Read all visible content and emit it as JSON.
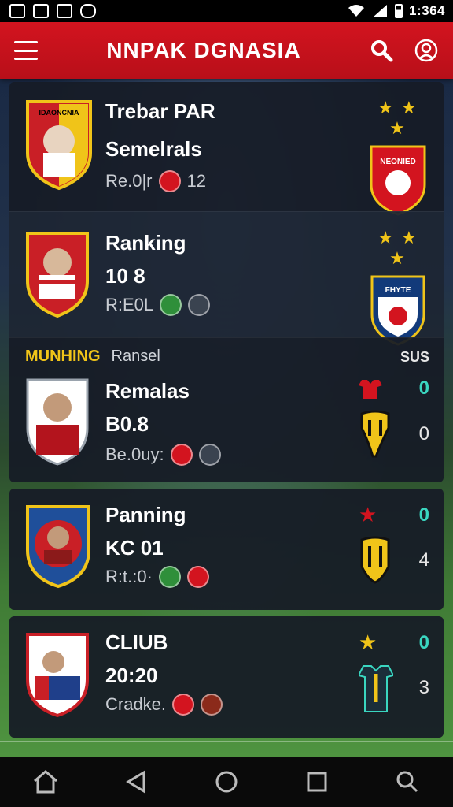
{
  "status_bar": {
    "time": "1:364",
    "left_icons": [
      "notification-icon",
      "image-icon",
      "mail-icon",
      "camera-icon"
    ],
    "right_icons": [
      "wifi-icon",
      "signal-icon",
      "battery-icon"
    ]
  },
  "app_bar": {
    "title": "NNPAK DGNASIA",
    "color": "#d3141f",
    "icons": [
      "menu-icon",
      "search-icon",
      "profile-icon"
    ]
  },
  "cards": [
    {
      "crest_text": "IDAONCNIA",
      "name": "Trebar PAR",
      "score": "Semelrals",
      "meta": "Re.0|r",
      "meta_num": "12",
      "stars": "★ ★ ★",
      "right_badge_text": "NEONIED"
    },
    {
      "name": "Ranking",
      "score": "10 8",
      "meta": "R:E0L",
      "stars": "★ ★ ★",
      "right_badge_text": "FHYTE"
    }
  ],
  "section": {
    "label_left": "MUNHING",
    "label_mid": "Ransel",
    "label_right": "SUS"
  },
  "section_cards": [
    {
      "name": "Remalas",
      "score": "B0.8",
      "meta": "Be.0uy:",
      "right_top": "0",
      "right_bottom": "0"
    },
    {
      "name": "Panning",
      "score": "KC 01",
      "meta": "R:t.:0·",
      "right_top": "0",
      "right_bottom": "4"
    },
    {
      "name": "CLIUB",
      "score": "20:20",
      "meta": "Cradke.",
      "right_top": "0",
      "right_bottom": "3"
    }
  ],
  "nav_bar": {
    "icons": [
      "home-icon",
      "back-icon",
      "home-circle-icon",
      "recents-icon",
      "search-icon"
    ]
  }
}
